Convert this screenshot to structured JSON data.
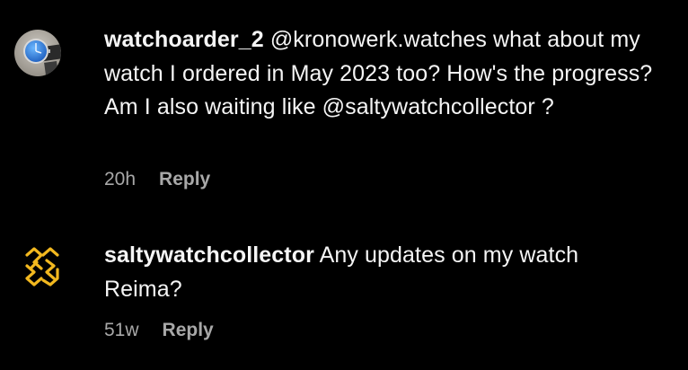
{
  "comments": [
    {
      "username": "watchoarder_2",
      "text": "@kronowerk.watches what about my watch I ordered in May 2023 too? How's the progress? Am I also waiting like @saltywatchcollector ?",
      "time": "20h",
      "reply_label": "Reply",
      "avatar_icon": "wristwatch-photo-avatar"
    },
    {
      "username": "saltywatchcollector",
      "text": "Any updates on my watch Reima?",
      "time": "51w",
      "reply_label": "Reply",
      "avatar_icon": "swc-monogram-logo",
      "avatar_color": "#f2b81f"
    }
  ]
}
